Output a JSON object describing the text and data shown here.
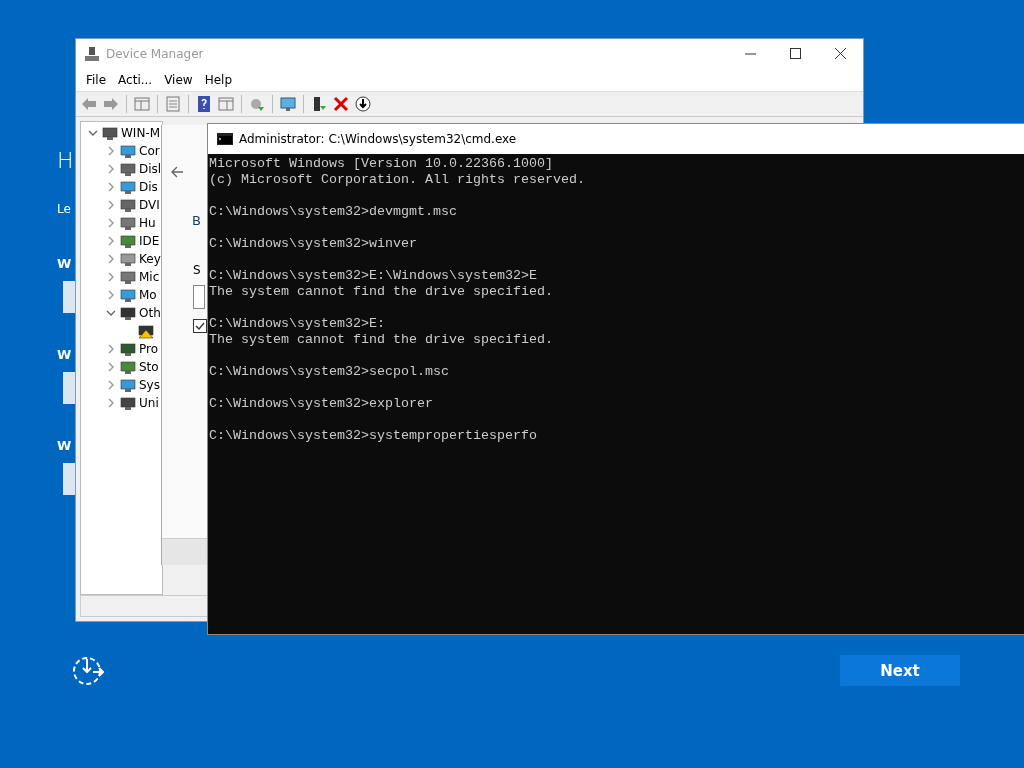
{
  "setup": {
    "heading": "H",
    "subtitle": "Le",
    "sections": [
      {
        "label": "W"
      },
      {
        "label": "W"
      },
      {
        "label": "W"
      }
    ],
    "next_button": "Next"
  },
  "device_manager": {
    "title": "Device Manager",
    "menu": [
      "File",
      "Acti...",
      "View",
      "Help"
    ],
    "tree": [
      {
        "label": "WIN-M",
        "kind": "computer",
        "expanded": true,
        "children": [
          {
            "label": "Cor",
            "kind": "monitor",
            "expanded": false
          },
          {
            "label": "Disl",
            "kind": "disk",
            "expanded": false
          },
          {
            "label": "Dis",
            "kind": "display",
            "expanded": false
          },
          {
            "label": "DVI",
            "kind": "disk",
            "expanded": false
          },
          {
            "label": "Hu",
            "kind": "hid",
            "expanded": false
          },
          {
            "label": "IDE",
            "kind": "card",
            "expanded": false
          },
          {
            "label": "Key",
            "kind": "keyboard",
            "expanded": false
          },
          {
            "label": "Mic",
            "kind": "mouse",
            "expanded": false
          },
          {
            "label": "Mo",
            "kind": "monitor",
            "expanded": false
          },
          {
            "label": "Oth",
            "kind": "unknown",
            "expanded": true,
            "children": [
              {
                "kind": "warning"
              }
            ]
          },
          {
            "label": "Pro",
            "kind": "chip",
            "expanded": false
          },
          {
            "label": "Sto",
            "kind": "card",
            "expanded": false
          },
          {
            "label": "Sys",
            "kind": "display",
            "expanded": false
          },
          {
            "label": "Uni",
            "kind": "usb",
            "expanded": false
          }
        ]
      }
    ]
  },
  "dialog": {
    "heading": "B",
    "label": "S",
    "checked": true
  },
  "console": {
    "title": "Administrator: C:\\Windows\\system32\\cmd.exe",
    "blocks": [
      [
        "Microsoft Windows [Version 10.0.22366.1000]",
        "(c) Microsoft Corporation. All rights reserved."
      ],
      [
        "C:\\Windows\\system32>devmgmt.msc"
      ],
      [
        "C:\\Windows\\system32>winver"
      ],
      [
        "C:\\Windows\\system32>E:\\Windows\\system32>E",
        "The system cannot find the drive specified."
      ],
      [
        "C:\\Windows\\system32>E:",
        "The system cannot find the drive specified."
      ],
      [
        "C:\\Windows\\system32>secpol.msc"
      ],
      [
        "C:\\Windows\\system32>explorer"
      ],
      [
        "C:\\Windows\\system32>systempropertiesperfo"
      ]
    ]
  }
}
